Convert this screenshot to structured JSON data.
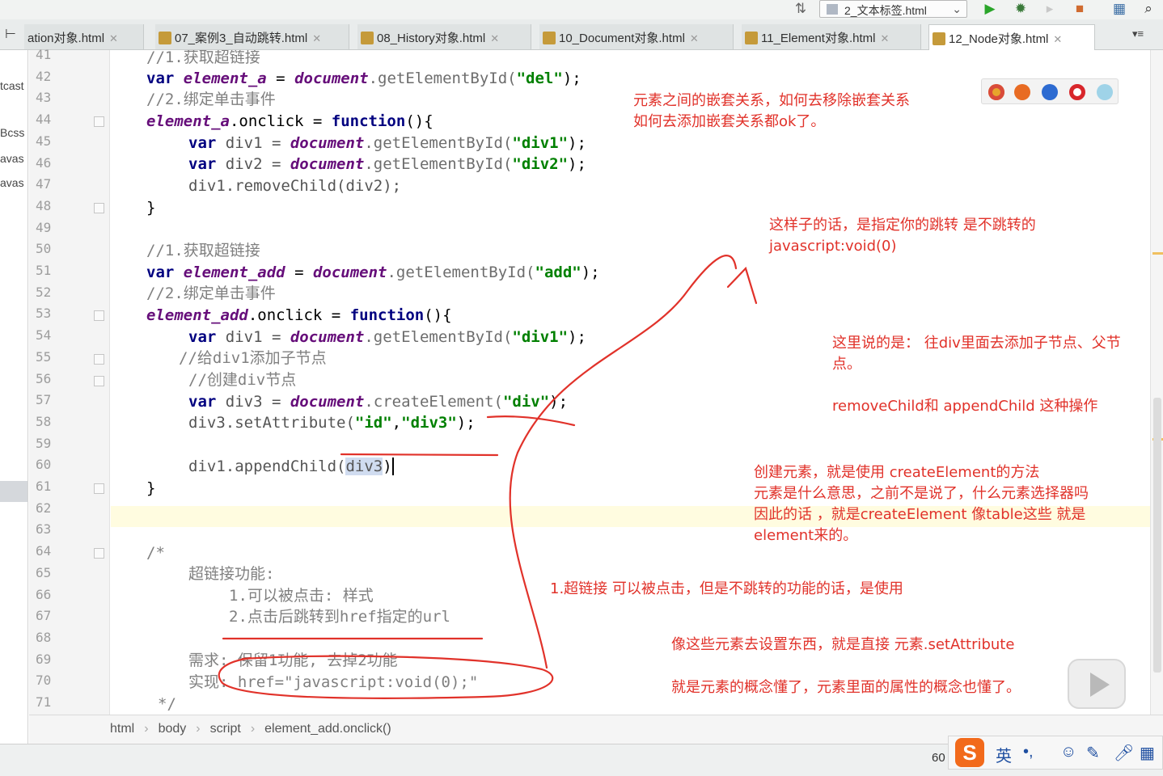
{
  "topbar": {
    "run_config": "2_文本标签.html"
  },
  "tabs": [
    {
      "label": "ation对象.html"
    },
    {
      "label": "07_案例3_自动跳转.html"
    },
    {
      "label": "08_History对象.html"
    },
    {
      "label": "10_Document对象.html"
    },
    {
      "label": "11_Element对象.html"
    },
    {
      "label": "12_Node对象.html"
    }
  ],
  "project_pane": [
    "tcast",
    "Bcss",
    "avas",
    "avas"
  ],
  "line_numbers": [
    "41",
    "42",
    "43",
    "44",
    "45",
    "46",
    "47",
    "48",
    "49",
    "50",
    "51",
    "52",
    "53",
    "54",
    "55",
    "56",
    "57",
    "58",
    "59",
    "60",
    "61",
    "62",
    "63",
    "64",
    "65",
    "66",
    "67",
    "68",
    "69",
    "70",
    "71"
  ],
  "code": {
    "l41": "//1.获取超链接",
    "l42": {
      "kw": "var",
      "v": "element_a",
      "eq": " = ",
      "obj": "document",
      "m": ".getElementById(",
      "s": "\"del\"",
      "end": ");"
    },
    "l43": "//2.绑定单击事件",
    "l44": {
      "v": "element_a",
      "rest": ".onclick = ",
      "kw": "function",
      "end": "(){"
    },
    "l45": {
      "kw": "var",
      "id": " div1 = ",
      "obj": "document",
      "m": ".getElementById(",
      "s": "\"div1\"",
      "end": ");"
    },
    "l46": {
      "kw": "var",
      "id": " div2 = ",
      "obj": "document",
      "m": ".getElementById(",
      "s": "\"div2\"",
      "end": ");"
    },
    "l47": "div1.removeChild(div2);",
    "l48": "}",
    "l50": "//1.获取超链接",
    "l51": {
      "kw": "var",
      "v": "element_add",
      "eq": " = ",
      "obj": "document",
      "m": ".getElementById(",
      "s": "\"add\"",
      "end": ");"
    },
    "l52": "//2.绑定单击事件",
    "l53": {
      "v": "element_add",
      "rest": ".onclick = ",
      "kw": "function",
      "end": "(){"
    },
    "l54": {
      "kw": "var",
      "id": " div1 = ",
      "obj": "document",
      "m": ".getElementById(",
      "s": "\"div1\"",
      "end": ");"
    },
    "l55": "//给div1添加子节点",
    "l56": "//创建div节点",
    "l57": {
      "kw": "var",
      "id": " div3 = ",
      "obj": "document",
      "m": ".createElement(",
      "s": "\"div\"",
      "end": ");"
    },
    "l58": {
      "pre": "div3.setAttribute(",
      "s1": "\"id\"",
      "comma": ",",
      "s2": "\"div3\"",
      "end": ");"
    },
    "l60": {
      "pre": "div1.appendChild(",
      "arg": "div3",
      "end": ")"
    },
    "l61": "}",
    "l64": "/*",
    "l65": "超链接功能:",
    "l66": "1.可以被点击: 样式",
    "l67": "2.点击后跳转到href指定的url",
    "l69": "需求: 保留1功能, 去掉2功能",
    "l70": "实现: href=\"javascript:void(0);\"",
    "l71": "*/"
  },
  "breadcrumb": [
    "html",
    "body",
    "script",
    "element_add.onclick()"
  ],
  "status": {
    "line_col": "60"
  },
  "ime": {
    "lang": "英",
    "punct": "•,"
  },
  "annotations": {
    "a1_l1": "元素之间的嵌套关系，如何去移除嵌套关系",
    "a1_l2": "如何去添加嵌套关系都ok了。",
    "a2_l1": "这样子的话，是指定你的跳转  是不跳转的",
    "a2_l2": "javascript:void(0)",
    "a3_l1": "这里说的是：  往div里面去添加子节点、父节",
    "a3_l2": "点。",
    "a3_l3": "removeChild和  appendChild 这种操作",
    "a4_l1": "创建元素，就是使用   createElement的方法",
    "a4_l2": "元素是什么意思，之前不是说了，什么元素选择器吗",
    "a4_l3": "因此的话 ，就是createElement   像table这些 就是",
    "a4_l4": "element来的。",
    "a5": "1.超链接  可以被点击，但是不跳转的功能的话，是使用",
    "a6": "像这些元素去设置东西，就是直接  元素.setAttribute",
    "a7": "就是元素的概念懂了，元素里面的属性的概念也懂了。"
  },
  "colors": {
    "annotation": "#e1322a",
    "keyword": "#000080",
    "variable": "#660e7a",
    "string": "#008000",
    "comment": "#808080",
    "caret_line": "#fffce0"
  }
}
